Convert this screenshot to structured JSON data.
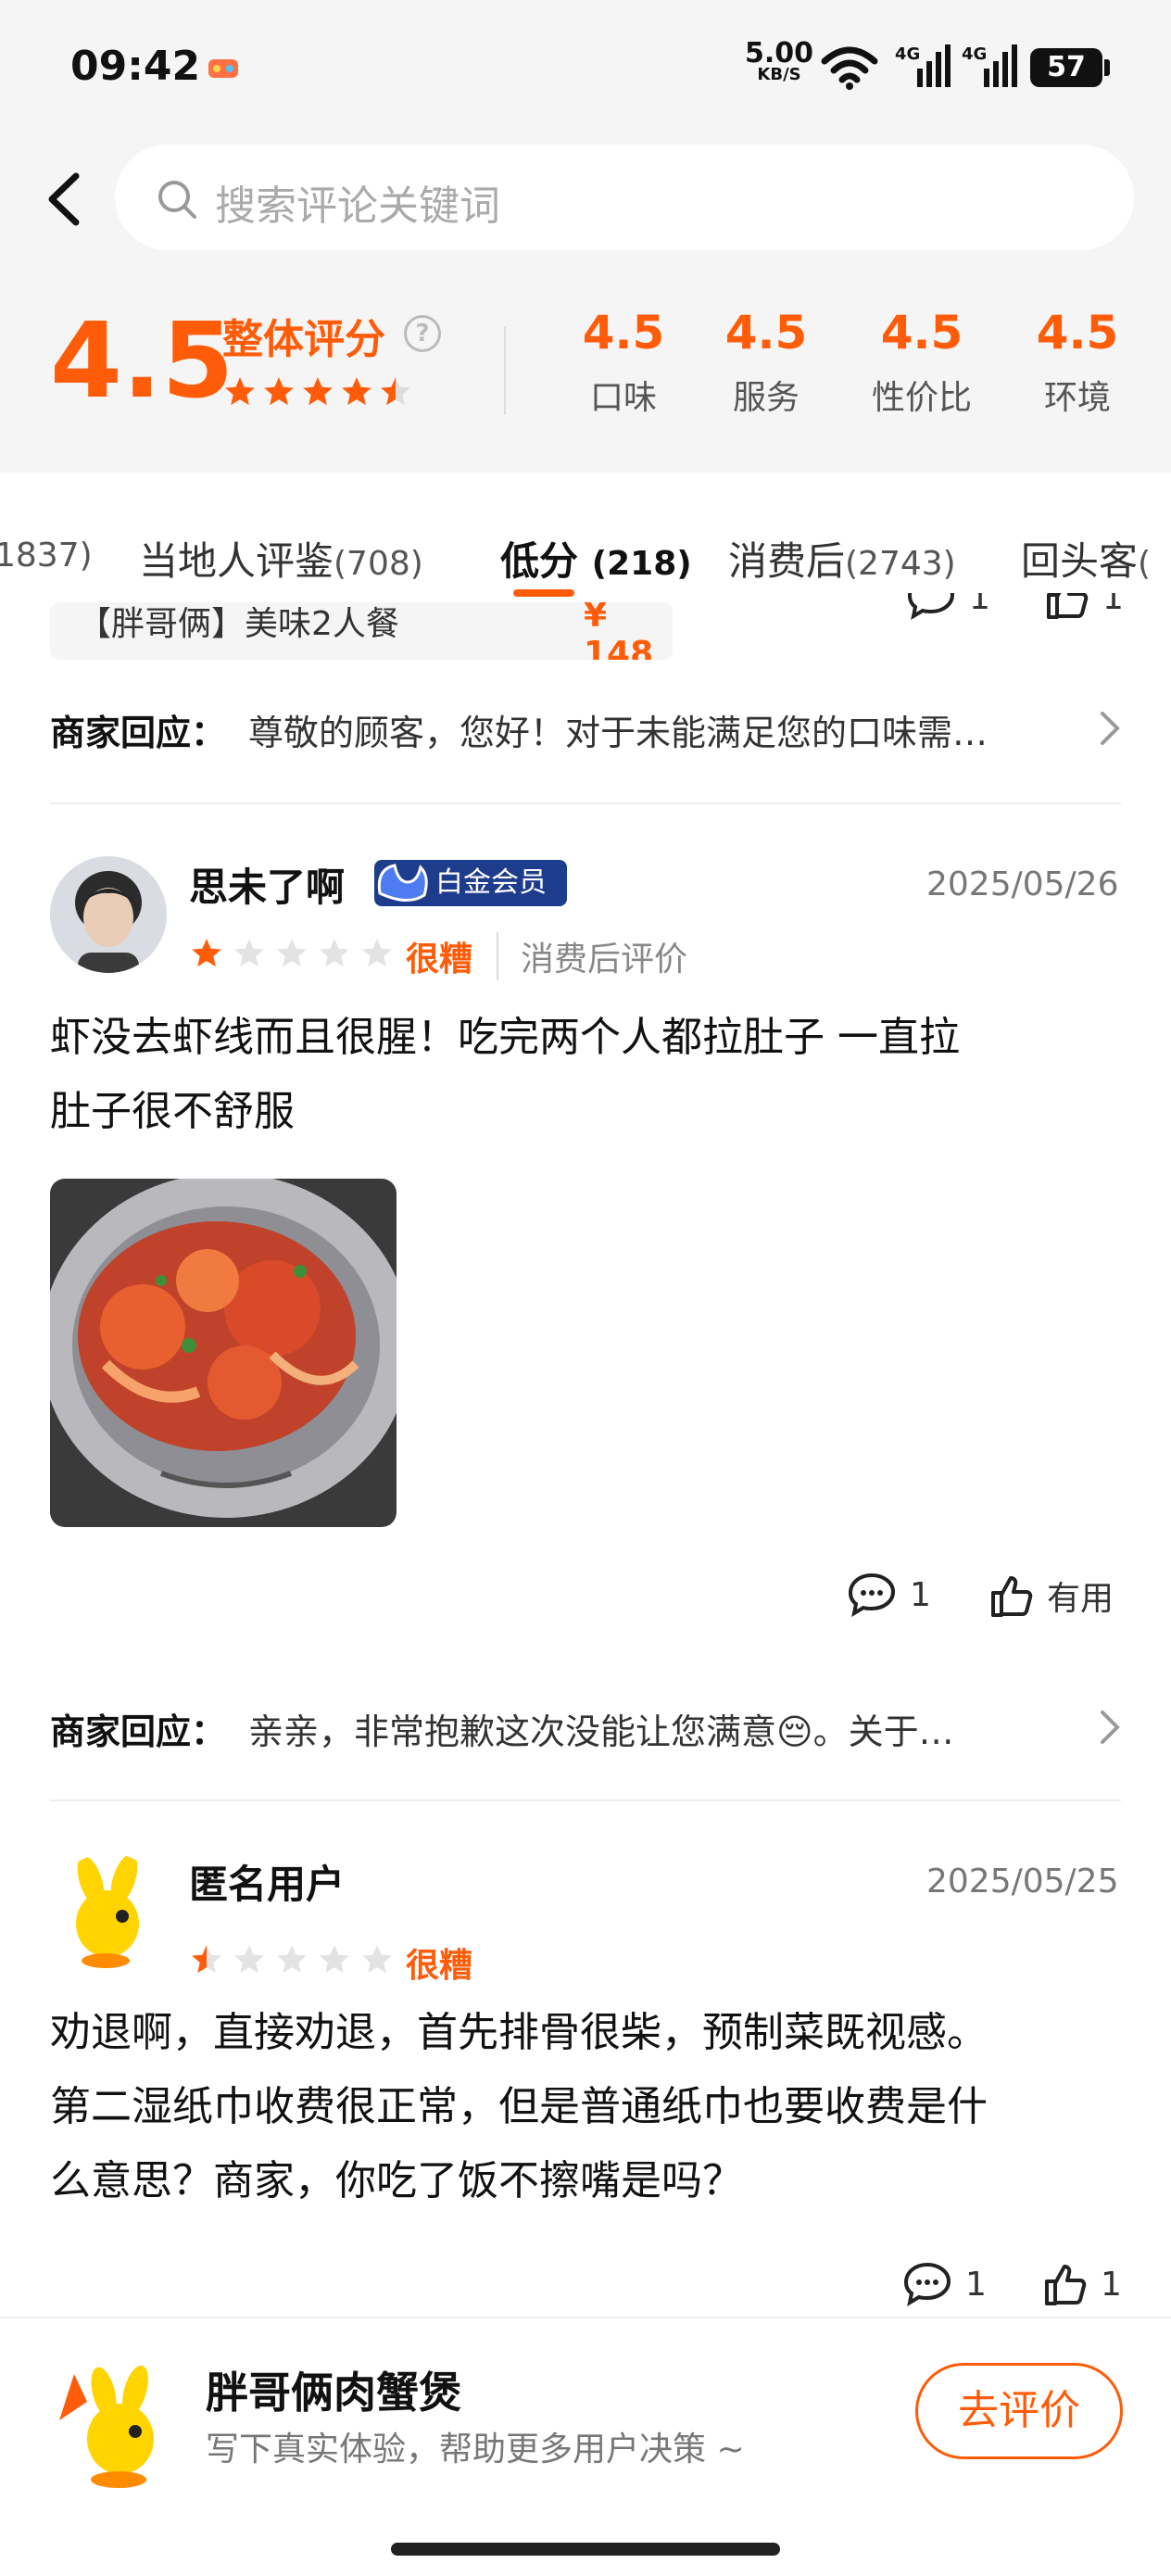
{
  "status_bar": {
    "time": "09:42",
    "net_speed": "5.00",
    "net_unit": "KB/S",
    "sig1": "4G",
    "sig2": "4G",
    "battery": "57"
  },
  "search": {
    "placeholder": "搜索评论关键词"
  },
  "summary": {
    "overall_score": "4.5",
    "overall_label": "整体评分",
    "overall_stars": 4.5,
    "sub_scores": [
      {
        "value": "4.5",
        "label": "口味"
      },
      {
        "value": "4.5",
        "label": "服务"
      },
      {
        "value": "4.5",
        "label": "性价比"
      },
      {
        "value": "4.5",
        "label": "环境"
      }
    ]
  },
  "tabs": [
    {
      "label": "",
      "count": "1837)"
    },
    {
      "label": "当地人评鉴",
      "count": "(708)"
    },
    {
      "label": "低分",
      "count": "(218)",
      "active": true
    },
    {
      "label": "消费后",
      "count": "(2743)"
    },
    {
      "label": "回头客",
      "count": "("
    }
  ],
  "prev_review": {
    "combo_name": "【胖哥俩】美味2人餐",
    "combo_price": "¥ 148",
    "comments": "1",
    "likes": "1",
    "reply_label": "商家回应：",
    "reply_text": "尊敬的顾客，您好！对于未能满足您的口味需…"
  },
  "reviews": [
    {
      "username": "思未了啊",
      "badge": "白金会员",
      "date": "2025/05/26",
      "stars": 1,
      "level": "很糟",
      "tag": "消费后评价",
      "text_line1": "虾没去虾线而且很腥！吃完两个人都拉肚子 一直拉",
      "text_line2": "肚子很不舒服",
      "comments": "1",
      "likes": "有用",
      "reply_label": "商家回应：",
      "reply_text": "亲亲，非常抱歉这次没能让您满意😔。关于…"
    },
    {
      "username": "匿名用户",
      "date": "2025/05/25",
      "stars": 0.5,
      "level": "很糟",
      "text_line1": "劝退啊，直接劝退，首先排骨很柴，预制菜既视感。",
      "text_line2": "第二湿纸巾收费很正常，但是普通纸巾也要收费是什",
      "text_line3": "么意思？商家，你吃了饭不擦嘴是吗？",
      "comments": "1",
      "likes": "1"
    }
  ],
  "bottom_bar": {
    "shop_name": "胖哥俩肉蟹煲",
    "subtitle": "写下真实体验，帮助更多用户决策 ~",
    "button": "去评价"
  },
  "colors": {
    "accent": "#ff5c0a",
    "badge_blue": "#1e3c8c"
  }
}
